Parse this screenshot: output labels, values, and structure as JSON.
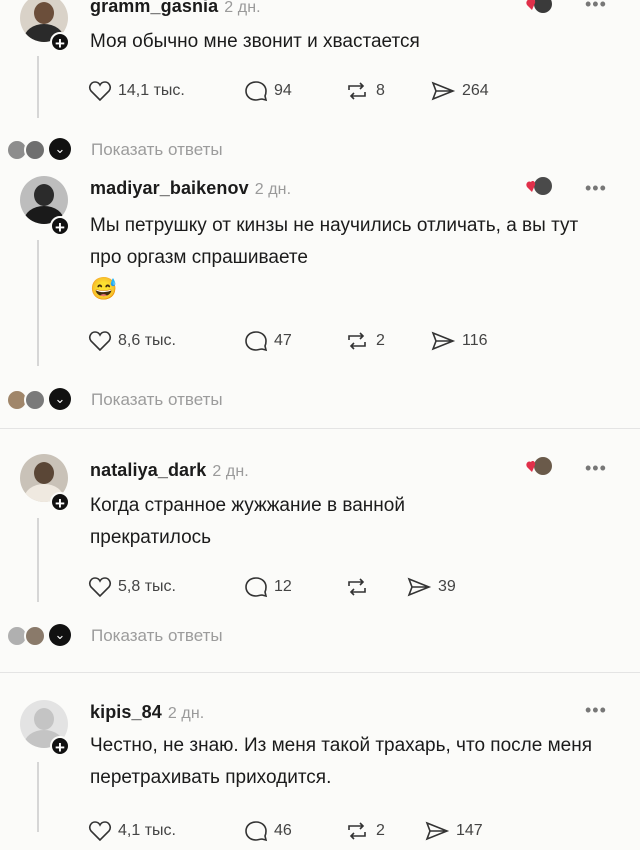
{
  "posts": [
    {
      "username": "gramm_gasnia",
      "time": "2 дн.",
      "text": "Моя обычно мне звонит и хвастается",
      "likes": "14,1 тыс.",
      "comments": "94",
      "reposts": "8",
      "shares": "264",
      "author_liked": true
    },
    {
      "username": "madiyar_baikenov",
      "time": "2 дн.",
      "text": "Мы петрушку от кинзы не научились отличать, а вы тут про оргазм спрашиваете",
      "emoji": "😅",
      "likes": "8,6 тыс.",
      "comments": "47",
      "reposts": "2",
      "shares": "116",
      "author_liked": true
    },
    {
      "username": "nataliya_dark",
      "time": "2 дн.",
      "text": "Когда странное жужжание в ванной прекратилось",
      "likes": "5,8 тыс.",
      "comments": "12",
      "reposts": "",
      "shares": "39",
      "author_liked": true
    },
    {
      "username": "kipis_84",
      "time": "2 дн.",
      "text": "Честно, не знаю. Из меня такой трахарь, что после меня перетрахивать приходится.",
      "likes": "4,1 тыс.",
      "comments": "46",
      "reposts": "2",
      "shares": "147",
      "author_liked": false
    }
  ],
  "show_replies_label": "Показать ответы",
  "colors": {
    "heart": "#e0304a",
    "muted": "#9c9c9c",
    "text": "#1b1b1b"
  }
}
